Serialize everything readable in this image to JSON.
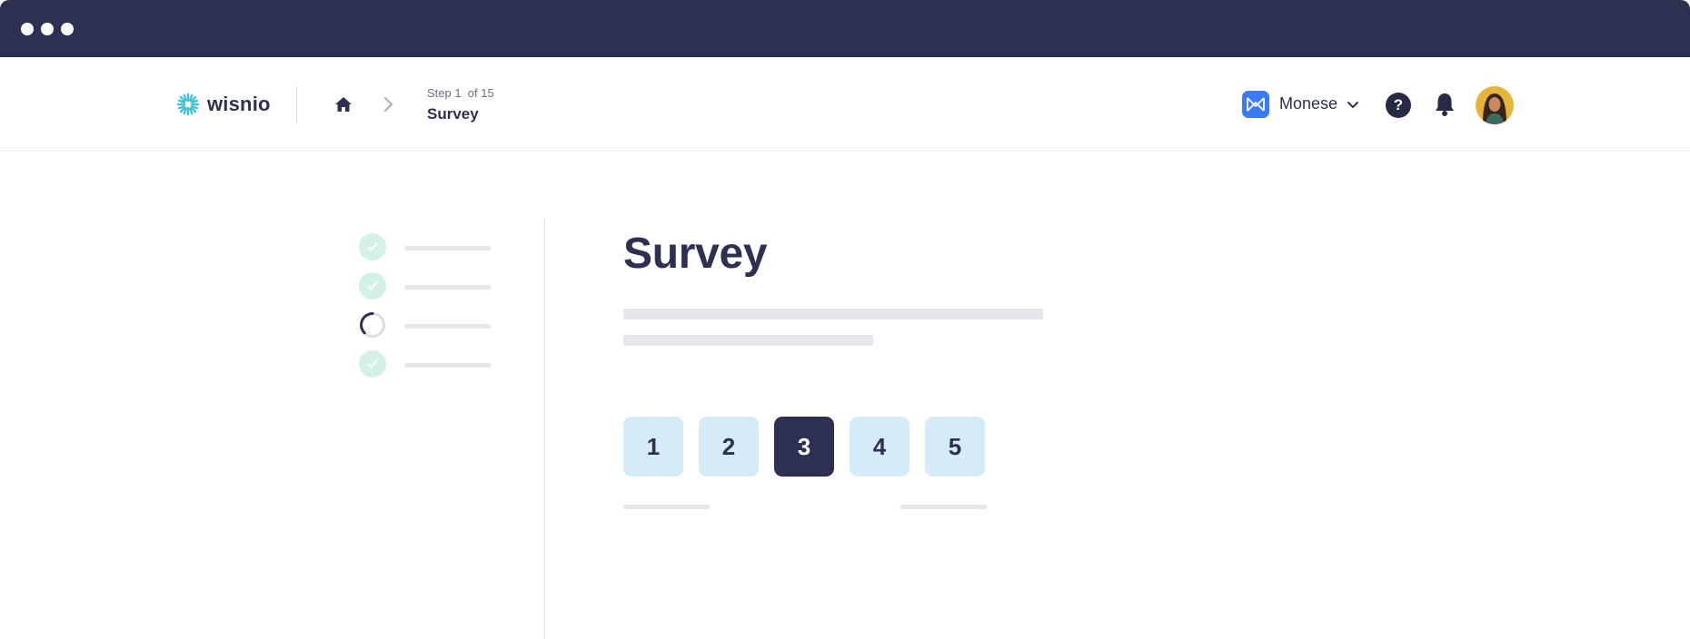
{
  "header": {
    "logo_text": "wisnio",
    "step_label": "Step 1  of 15",
    "step_title": "Survey",
    "org_name": "Monese",
    "help_glyph": "?"
  },
  "steps": [
    {
      "status": "completed",
      "icon": "check-icon"
    },
    {
      "status": "completed",
      "icon": "check-icon"
    },
    {
      "status": "in-progress",
      "icon": "spinner-icon"
    },
    {
      "status": "completed",
      "icon": "check-icon"
    }
  ],
  "main": {
    "title": "Survey",
    "rating_options": [
      "1",
      "2",
      "3",
      "4",
      "5"
    ],
    "selected_rating": "3"
  },
  "colors": {
    "chrome": "#2d3050",
    "accent_dark": "#2d3050",
    "rating_bg": "#d6ebf8",
    "check_bg": "#d4f1e5",
    "check_fg": "#3fbf8c",
    "logo_teal": "#3fc3d8",
    "org_blue": "#3a7bf5",
    "placeholder": "#e6e7ea"
  }
}
